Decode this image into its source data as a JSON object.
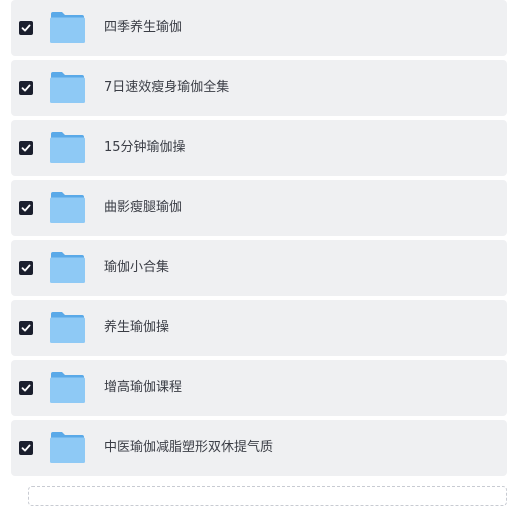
{
  "folders": [
    {
      "name": "四季养生瑜伽",
      "checked": true
    },
    {
      "name": "7日速效瘦身瑜伽全集",
      "checked": true
    },
    {
      "name": "15分钟瑜伽操",
      "checked": true
    },
    {
      "name": "曲影瘦腿瑜伽",
      "checked": true
    },
    {
      "name": "瑜伽小合集",
      "checked": true
    },
    {
      "name": "养生瑜伽操",
      "checked": true
    },
    {
      "name": "增高瑜伽课程",
      "checked": true
    },
    {
      "name": "中医瑜伽减脂塑形双休提气质",
      "checked": true
    }
  ],
  "icons": {
    "checkbox": "checkmark-icon",
    "folder": "folder-icon"
  },
  "colors": {
    "row_bg": "#eff0f2",
    "checkbox_bg": "#1b1f2e",
    "folder_light": "#8ec9f5",
    "folder_dark": "#5aa9e8"
  }
}
